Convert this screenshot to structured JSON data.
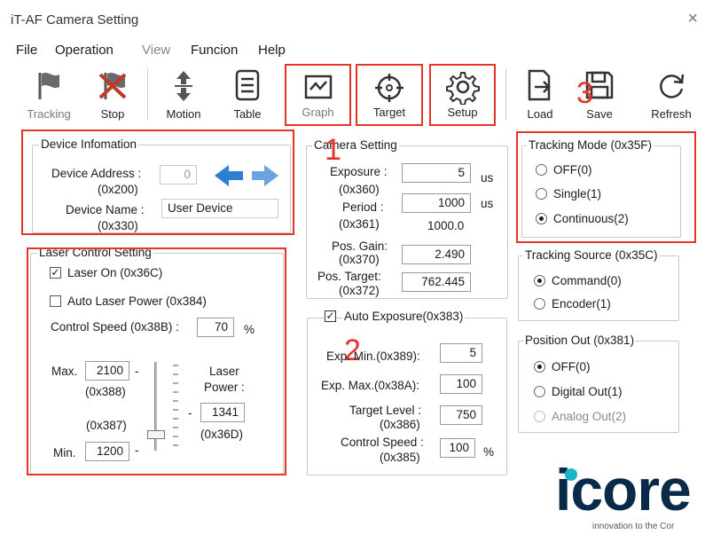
{
  "window": {
    "title": "iT-AF Camera Setting",
    "close_glyph": "×"
  },
  "menu": [
    "File",
    "Operation",
    "View",
    "Funcion",
    "Help"
  ],
  "toolbar": {
    "tracking": "Tracking",
    "stop": "Stop",
    "motion": "Motion",
    "table": "Table",
    "graph": "Graph",
    "target": "Target",
    "setup": "Setup",
    "load": "Load",
    "save": "Save",
    "refresh": "Refresh"
  },
  "device": {
    "legend": "Device Infomation",
    "address_label": "Device Address :",
    "address_reg": "(0x200)",
    "address_value": "0",
    "name_label": "Device Name :",
    "name_reg": "(0x330)",
    "name_value": "User Device"
  },
  "camera": {
    "legend": "Camera Setting",
    "exposure_label": "Exposure :",
    "exposure_reg": "(0x360)",
    "exposure_value": "5",
    "exposure_unit": "us",
    "period_label": "Period :",
    "period_reg": "(0x361)",
    "period_value": "1000",
    "period_unit": "us",
    "period_readout": "1000.0",
    "gain_label": "Pos. Gain:",
    "gain_reg": "(0x370)",
    "gain_value": "2.490",
    "target_label": "Pos. Target:",
    "target_reg": "(0x372)",
    "target_value": "762.445"
  },
  "laser": {
    "legend": "Laser Control Setting",
    "laser_on": "Laser On  (0x36C)",
    "auto_power": "Auto Laser Power (0x384)",
    "speed_label": "Control Speed (0x38B) :",
    "speed_value": "70",
    "speed_unit": "%",
    "max_label": "Max.",
    "max_value": "2100",
    "max_reg": "(0x388)",
    "min_label": "Min.",
    "min_value": "1200",
    "min_reg": "(0x387)",
    "power_label_1": "Laser",
    "power_label_2": "Power :",
    "power_value": "1341",
    "power_reg": "(0x36D)",
    "dash": "-"
  },
  "auto_exposure": {
    "legend": "Auto Exposure(0x383)",
    "exp_min_label": "Exp. Min.(0x389):",
    "exp_min_value": "5",
    "exp_max_label": "Exp. Max.(0x38A):",
    "exp_max_value": "100",
    "target_label": "Target Level :",
    "target_reg": "(0x386)",
    "target_value": "750",
    "speed_label": "Control Speed :",
    "speed_reg": "(0x385)",
    "speed_value": "100",
    "speed_unit": "%"
  },
  "tracking_mode": {
    "legend": "Tracking Mode (0x35F)",
    "options": [
      "OFF(0)",
      "Single(1)",
      "Continuous(2)"
    ],
    "selected": 2
  },
  "tracking_source": {
    "legend": "Tracking Source (0x35C)",
    "options": [
      "Command(0)",
      "Encoder(1)"
    ],
    "selected": 0
  },
  "position_out": {
    "legend": "Position Out (0x381)",
    "options": [
      "OFF(0)",
      "Digital Out(1)",
      "Analog Out(2)"
    ],
    "selected": 0
  },
  "annotations": {
    "n1": "1",
    "n2": "2",
    "n3": "3",
    "accent": "#e5352b"
  },
  "logo": {
    "text": "icore",
    "tagline": "innovation to the Cor",
    "color": "#0a2a4a",
    "dot_color": "#19b6c9"
  }
}
